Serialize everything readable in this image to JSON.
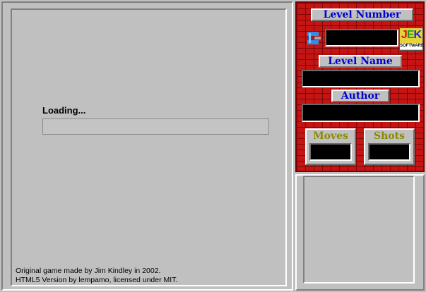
{
  "loading": {
    "label": "Loading...",
    "progress": 0
  },
  "credits": {
    "line1": "Original game made by Jim Kindley in 2002.",
    "line2": "HTML5 Version by lempamo, licensed under MIT."
  },
  "panel": {
    "level_number_title": "Level Number",
    "level_name_title": "Level Name",
    "author_title": "Author",
    "moves_title": "Moves",
    "shots_title": "Shots",
    "level_number_value": "",
    "level_name_value": "",
    "author_value": "",
    "moves_value": "",
    "shots_value": ""
  },
  "logo": {
    "letters": "JEK",
    "subtitle": "SOFTWARE"
  },
  "colors": {
    "panel_brick": "#c41414",
    "title_text": "#0000d0",
    "counter_text": "#8a8a00",
    "display_bg": "#000000"
  },
  "icons": {
    "prev_level": "prev-level-icon",
    "logo": "jek-software-logo"
  }
}
